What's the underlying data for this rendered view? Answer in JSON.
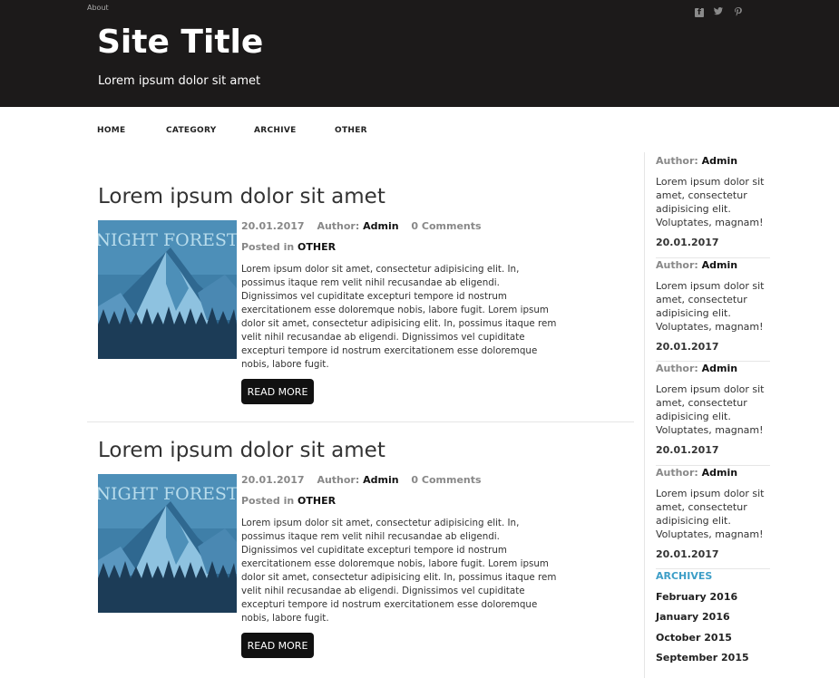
{
  "header": {
    "top_link": "About",
    "site_title": "Site Title",
    "tagline": "Lorem ipsum dolor sit amet",
    "social_icons": [
      "facebook-icon",
      "twitter-icon",
      "pinterest-icon"
    ]
  },
  "nav": {
    "items": [
      "HOME",
      "CATEGORY",
      "ARCHIVE",
      "OTHER"
    ]
  },
  "posts": [
    {
      "title": "Lorem ipsum dolor sit amet",
      "thumb_text": "NIGHT FOREST",
      "date": "20.01.2017",
      "author_label": "Author:",
      "author": "Admin",
      "comments": "0 Comments",
      "posted_label": "Posted in",
      "category": "OTHER",
      "excerpt": "Lorem ipsum dolor sit amet, consectetur adipisicing elit. In, possimus itaque rem velit nihil recusandae ab eligendi. Dignissimos vel cupiditate excepturi tempore id nostrum exercitationem esse doloremque nobis, labore fugit. Lorem ipsum dolor sit amet, consectetur adipisicing elit. In, possimus itaque rem velit nihil recusandae ab eligendi. Dignissimos vel cupiditate excepturi tempore id nostrum exercitationem esse doloremque nobis, labore fugit.",
      "button": "READ MORE"
    },
    {
      "title": "Lorem ipsum dolor sit amet",
      "thumb_text": "NIGHT FOREST",
      "date": "20.01.2017",
      "author_label": "Author:",
      "author": "Admin",
      "comments": "0 Comments",
      "posted_label": "Posted in",
      "category": "OTHER",
      "excerpt": "Lorem ipsum dolor sit amet, consectetur adipisicing elit. In, possimus itaque rem velit nihil recusandae ab eligendi. Dignissimos vel cupiditate excepturi tempore id nostrum exercitationem esse doloremque nobis, labore fugit. Lorem ipsum dolor sit amet, consectetur adipisicing elit. In, possimus itaque rem velit nihil recusandae ab eligendi. Dignissimos vel cupiditate excepturi tempore id nostrum exercitationem esse doloremque nobis, labore fugit.",
      "button": "READ MORE"
    }
  ],
  "sidebar": {
    "entries": [
      {
        "author_label": "Author:",
        "author": "Admin",
        "text": "Lorem ipsum dolor sit amet, consectetur adipisicing elit. Voluptates, magnam!",
        "date": "20.01.2017"
      },
      {
        "author_label": "Author:",
        "author": "Admin",
        "text": "Lorem ipsum dolor sit amet, consectetur adipisicing elit. Voluptates, magnam!",
        "date": "20.01.2017"
      },
      {
        "author_label": "Author:",
        "author": "Admin",
        "text": "Lorem ipsum dolor sit amet, consectetur adipisicing elit. Voluptates, magnam!",
        "date": "20.01.2017"
      },
      {
        "author_label": "Author:",
        "author": "Admin",
        "text": "Lorem ipsum dolor sit amet, consectetur adipisicing elit. Voluptates, magnam!",
        "date": "20.01.2017"
      }
    ],
    "archives_title": "ARCHIVES",
    "archives": [
      "February 2016",
      "January 2016",
      "October 2015",
      "September 2015"
    ]
  },
  "colors": {
    "header_bg": "#1c1a1a",
    "accent": "#3d9ec7",
    "button_bg": "#111111"
  }
}
